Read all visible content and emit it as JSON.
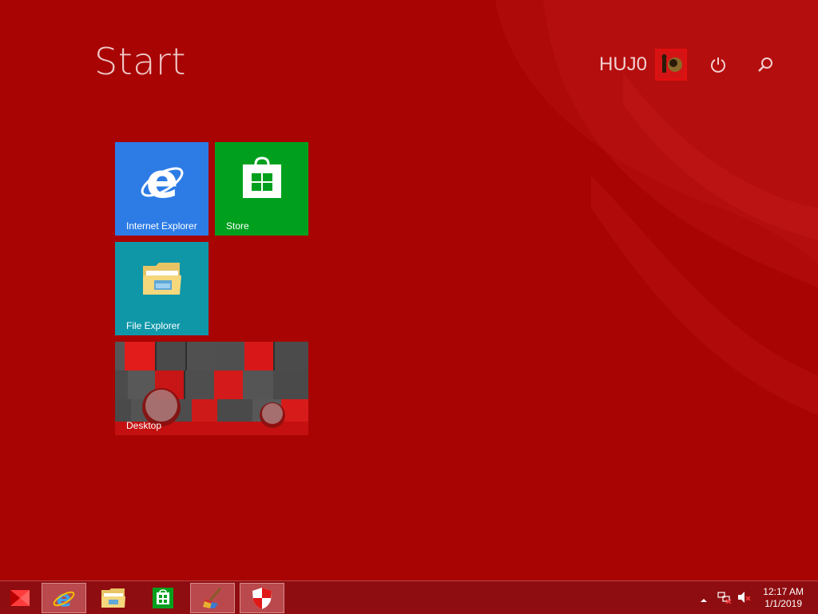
{
  "start": {
    "title": "Start"
  },
  "user": {
    "name": "HUJ0",
    "avatar_icon": "user-avatar-icon"
  },
  "top_buttons": {
    "power_icon": "power-icon",
    "search_icon": "search-icon"
  },
  "tiles": [
    {
      "label": "Internet Explorer",
      "color": "#2d7ce6",
      "icon": "internet-explorer-icon"
    },
    {
      "label": "Store",
      "color": "#00a01e",
      "icon": "store-icon"
    },
    {
      "label": "File Explorer",
      "color": "#0f97a8",
      "icon": "file-explorer-icon"
    },
    {
      "label": "Desktop",
      "color": "#3a3a3a",
      "icon": "desktop-wallpaper"
    }
  ],
  "taskbar": {
    "start_icon": "windows-start-icon",
    "pinned": [
      {
        "name": "internet-explorer",
        "icon": "internet-explorer-icon",
        "active": true
      },
      {
        "name": "file-explorer",
        "icon": "folder-icon",
        "active": false
      },
      {
        "name": "store",
        "icon": "store-icon",
        "active": false
      },
      {
        "name": "ccleaner",
        "icon": "ccleaner-icon",
        "active": true
      },
      {
        "name": "security",
        "icon": "shield-icon",
        "active": true
      }
    ],
    "tray": {
      "show_hidden_icon": "chevron-up-icon",
      "network_icon": "network-icon",
      "volume_icon": "volume-muted-icon"
    },
    "clock": {
      "time": "12:17 AM",
      "date": "1/1/2019"
    }
  },
  "colors": {
    "background": "#a80404",
    "taskbar": "#8e0d10",
    "accent": "#e01010"
  }
}
